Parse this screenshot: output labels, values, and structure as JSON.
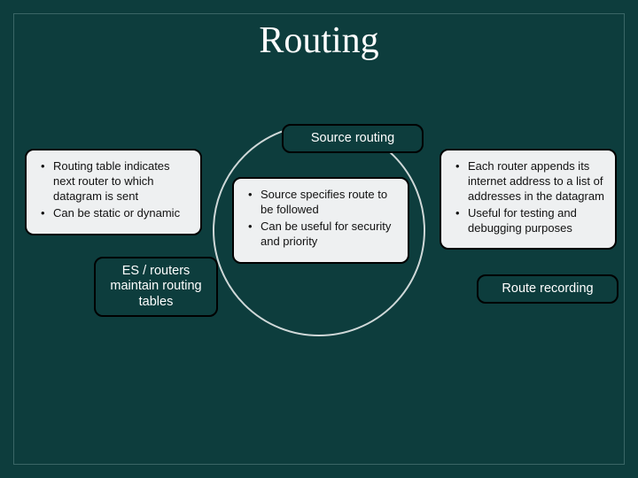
{
  "title": "Routing",
  "cards": {
    "c1": {
      "label": "ES / routers maintain routing tables",
      "items": [
        "Routing table indicates next router to which datagram is sent",
        "Can be static or dynamic"
      ]
    },
    "c2": {
      "label": "Source routing",
      "items": [
        "Source specifies route to be followed",
        "Can be useful for security and priority"
      ]
    },
    "c3": {
      "label": "Route recording",
      "items": [
        "Each router appends its internet address to a list of addresses in the datagram",
        "Useful for testing and debugging purposes"
      ]
    }
  }
}
